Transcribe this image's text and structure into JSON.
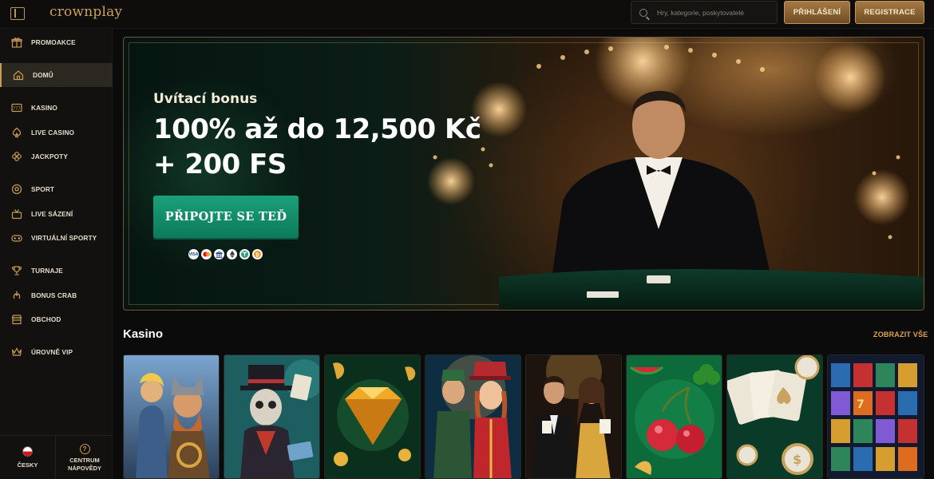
{
  "header": {
    "logo_text": "crownplay",
    "search_placeholder": "Hry, kategorie, poskytovatelé",
    "login_label": "PŘIHLÁŠENÍ",
    "register_label": "REGISTRACE"
  },
  "sidebar": {
    "items": [
      {
        "label": "PROMOAKCE",
        "icon": "gift-icon"
      },
      {
        "label": "DOMŮ",
        "icon": "home-icon",
        "active": true
      },
      {
        "label": "KASINO",
        "icon": "slot-777-icon"
      },
      {
        "label": "LIVE CASINO",
        "icon": "spade-icon"
      },
      {
        "label": "JACKPOTY",
        "icon": "clover-icon"
      },
      {
        "label": "SPORT",
        "icon": "soccer-ball-icon"
      },
      {
        "label": "LIVE SÁZENÍ",
        "icon": "live-betting-icon"
      },
      {
        "label": "VIRTUÁLNÍ SPORTY",
        "icon": "gamepad-icon"
      },
      {
        "label": "TURNAJE",
        "icon": "trophy-icon"
      },
      {
        "label": "BONUS CRAB",
        "icon": "claw-icon"
      },
      {
        "label": "OBCHOD",
        "icon": "shop-icon"
      },
      {
        "label": "ÚROVNĚ VIP",
        "icon": "crown-icon"
      }
    ],
    "language_label": "ČESKY",
    "help_label_line1": "CENTRUM",
    "help_label_line2": "NÁPOVĚDY"
  },
  "hero": {
    "subtitle": "Uvítací bonus",
    "title_line1": "100% až do 12,500 Kč",
    "title_line2": "+ 200 FS",
    "cta_label": "PŘIPOJTE SE TEĎ",
    "payment_icons": [
      "visa-icon",
      "mastercard-icon",
      "bank-icon",
      "ethereum-icon",
      "tether-icon",
      "bitcoin-icon"
    ],
    "payment_visa_text": "VISA"
  },
  "casino_section": {
    "title": "Kasino",
    "see_all_label": "ZOBRAZIT VŠE",
    "games": [
      {
        "theme": "viking-couple",
        "colors": [
          "#5a89b8",
          "#c9852e"
        ]
      },
      {
        "theme": "top-hat-skeleton",
        "colors": [
          "#1a6a6a",
          "#c0392b"
        ]
      },
      {
        "theme": "golden-diamond",
        "colors": [
          "#0d3b22",
          "#e7a630"
        ]
      },
      {
        "theme": "ringmaster-duo",
        "colors": [
          "#0e2a3f",
          "#c0272d"
        ]
      },
      {
        "theme": "live-dealers",
        "colors": [
          "#1d1511",
          "#d8a63c"
        ]
      },
      {
        "theme": "fruit-cherries",
        "colors": [
          "#0e6b3c",
          "#d42a3a"
        ]
      },
      {
        "theme": "cards-chips",
        "colors": [
          "#0a3b2a",
          "#e9e4d6"
        ]
      },
      {
        "theme": "slot-reels",
        "colors": [
          "#14203a",
          "#e6b53a"
        ]
      }
    ]
  }
}
